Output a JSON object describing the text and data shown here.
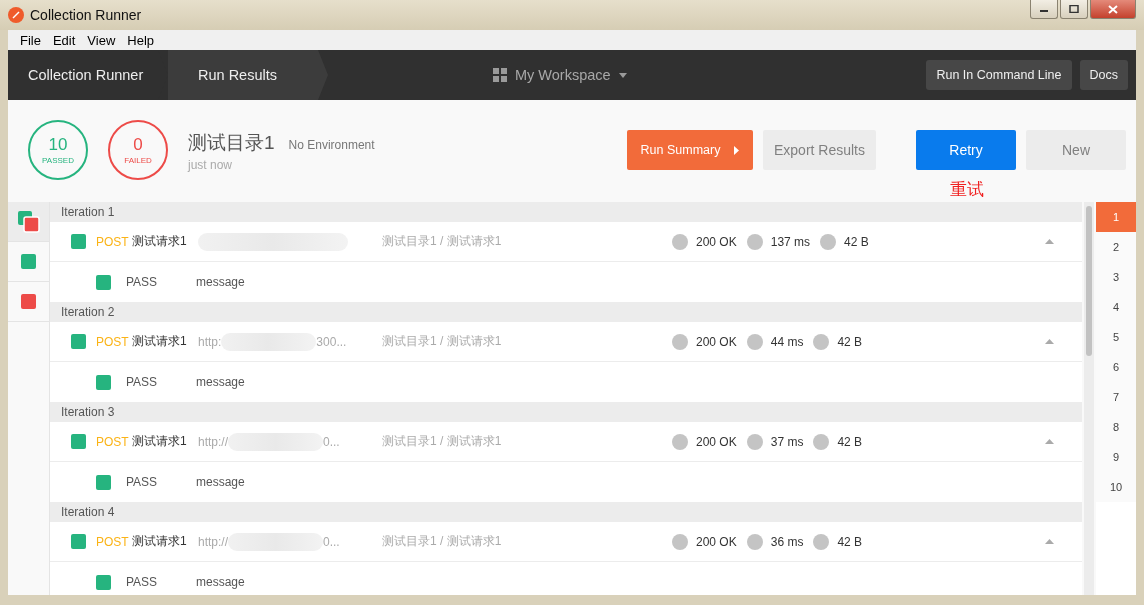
{
  "window": {
    "title": "Collection Runner"
  },
  "menu": [
    "File",
    "Edit",
    "View",
    "Help"
  ],
  "breadcrumb": [
    {
      "label": "Collection Runner",
      "selected": false
    },
    {
      "label": "Run Results",
      "selected": true
    }
  ],
  "workspace": {
    "label": "My Workspace"
  },
  "toolbar_buttons": [
    "Run In Command Line",
    "Docs"
  ],
  "summary": {
    "passed": {
      "count": "10",
      "label": "PASSED"
    },
    "failed": {
      "count": "0",
      "label": "FAILED"
    },
    "collection": "测试目录1",
    "environment": "No Environment",
    "time": "just now"
  },
  "actions": [
    {
      "label": "Run Summary",
      "kind": "summary"
    },
    {
      "label": "Export Results",
      "kind": "secondary"
    },
    {
      "label": "Retry",
      "kind": "primary"
    },
    {
      "label": "New",
      "kind": "secondary"
    }
  ],
  "annotation": "重试",
  "filters": [
    {
      "kind": "all",
      "selected": true
    },
    {
      "kind": "passed",
      "selected": false
    },
    {
      "kind": "failed",
      "selected": false
    }
  ],
  "iterations": [
    {
      "title": "Iteration 1",
      "request": {
        "method": "POST",
        "name": "测试请求1",
        "path": "测试目录1 / 测试请求1",
        "status": "200 OK",
        "time": "137 ms",
        "size": "42 B",
        "expanded": true
      },
      "tests": [
        {
          "result": "PASS",
          "passed": true,
          "name": "message"
        }
      ]
    },
    {
      "title": "Iteration 2",
      "request": {
        "method": "POST",
        "name": "测试请求1",
        "url_start": "http:",
        "url_end": "300...",
        "path": "测试目录1 / 测试请求1",
        "status": "200 OK",
        "time": "44 ms",
        "size": "42 B",
        "expanded": true
      },
      "tests": [
        {
          "result": "PASS",
          "passed": true,
          "name": "message"
        }
      ]
    },
    {
      "title": "Iteration 3",
      "request": {
        "method": "POST",
        "name": "测试请求1",
        "url_start": "http://",
        "url_end": "0...",
        "path": "测试目录1 / 测试请求1",
        "status": "200 OK",
        "time": "37 ms",
        "size": "42 B",
        "expanded": true
      },
      "tests": [
        {
          "result": "PASS",
          "passed": true,
          "name": "message"
        }
      ]
    },
    {
      "title": "Iteration 4",
      "request": {
        "method": "POST",
        "name": "测试请求1",
        "url_start": "http://",
        "url_end": "0...",
        "path": "测试目录1 / 测试请求1",
        "status": "200 OK",
        "time": "36 ms",
        "size": "42 B",
        "expanded": true
      },
      "tests": [
        {
          "result": "PASS",
          "passed": true,
          "name": "message"
        }
      ]
    }
  ],
  "iteration_index": [
    {
      "label": "1",
      "selected": true
    },
    {
      "label": "2",
      "selected": false
    },
    {
      "label": "3",
      "selected": false
    },
    {
      "label": "4",
      "selected": false
    },
    {
      "label": "5",
      "selected": false
    },
    {
      "label": "6",
      "selected": false
    },
    {
      "label": "7",
      "selected": false
    },
    {
      "label": "8",
      "selected": false
    },
    {
      "label": "9",
      "selected": false
    },
    {
      "label": "10",
      "selected": false
    }
  ]
}
